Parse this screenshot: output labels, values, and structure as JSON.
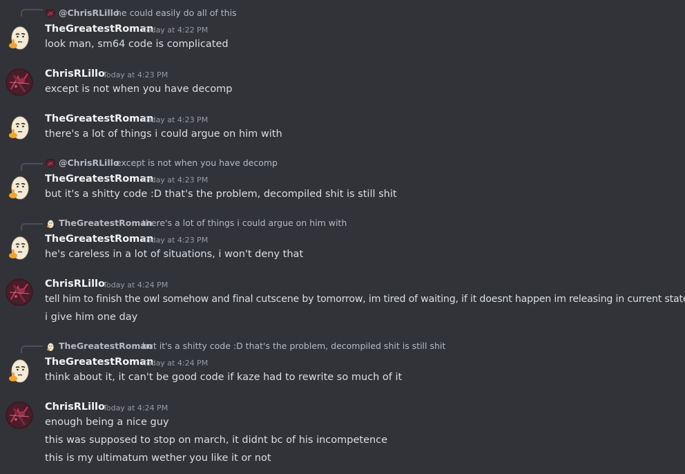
{
  "messages": [
    {
      "reply": {
        "name": "@ChrisRLillo",
        "text": "he could easily do all of this"
      },
      "author": "TheGreatestRoman",
      "time": "Today at 4:22 PM",
      "lines": [
        "look man, sm64 code is complicated"
      ]
    },
    {
      "author": "ChrisRLillo",
      "time": "Today at 4:23 PM",
      "lines": [
        "except is not when you have decomp"
      ]
    },
    {
      "author": "TheGreatestRoman",
      "time": "Today at 4:23 PM",
      "lines": [
        "there's a lot of things i could argue on him with"
      ]
    },
    {
      "reply": {
        "name": "@ChrisRLillo",
        "text": "except is not when you have decomp"
      },
      "author": "TheGreatestRoman",
      "time": "Today at 4:23 PM",
      "lines": [
        "but it's a shitty code :D that's the problem, decompiled shit is still shit"
      ]
    },
    {
      "reply": {
        "name": "TheGreatestRoman",
        "text": "there's a lot of things i could argue on him with"
      },
      "author": "TheGreatestRoman",
      "time": "Today at 4:23 PM",
      "lines": [
        "he's careless in a lot of situations, i won't deny that"
      ]
    },
    {
      "author": "ChrisRLillo",
      "time": "Today at 4:24 PM",
      "lines": [
        "tell him to finish the owl somehow and final cutscene by tomorrow, im tired of waiting, if it doesnt happen im releasing in current state",
        "i give him one day"
      ]
    },
    {
      "reply": {
        "name": "TheGreatestRoman",
        "text": "but it's a shitty code :D that's the problem, decompiled shit is still shit"
      },
      "author": "TheGreatestRoman",
      "time": "Today at 4:24 PM",
      "lines": [
        "think about it, it can't be good code if kaze had to rewrite so much of it"
      ]
    },
    {
      "author": "ChrisRLillo",
      "time": "Today at 4:24 PM",
      "lines": [
        "enough being a nice guy",
        "this was supposed to stop on march, it didnt bc of his incompetence",
        "this is my ultimatum wether you like it or not"
      ]
    }
  ],
  "colors": {
    "background": "#313338",
    "author": "#f2f3f5",
    "text": "#dbdee1",
    "timestamp": "#949ba4",
    "reply": "#b5bac1"
  },
  "icons": {
    "egg_avatar": "thinking-egg-avatar-icon",
    "chris_avatar": "dark-red-art-avatar-icon"
  }
}
